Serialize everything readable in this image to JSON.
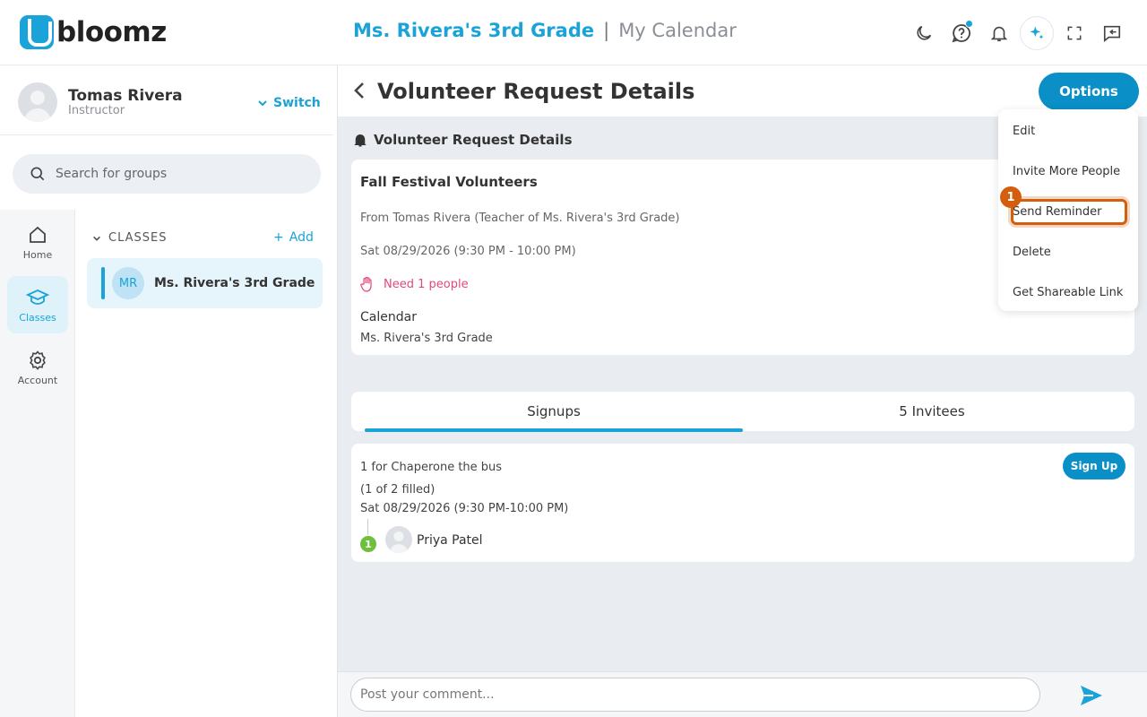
{
  "app": {
    "logo_text": "bloomz"
  },
  "header": {
    "group_name": "Ms. Rivera's 3rd Grade",
    "separator": "|",
    "page_name": "My Calendar",
    "icons": [
      "moon-icon",
      "help-icon",
      "bell-icon",
      "sparkle-icon",
      "fullscreen-icon",
      "message-icon"
    ]
  },
  "profile": {
    "name": "Tomas Rivera",
    "role": "Instructor",
    "switch_label": "Switch"
  },
  "search": {
    "placeholder": "Search for groups"
  },
  "rail": {
    "items": [
      {
        "label": "Home",
        "icon": "home-icon",
        "active": false
      },
      {
        "label": "Classes",
        "icon": "graduation-cap-icon",
        "active": true
      },
      {
        "label": "Account",
        "icon": "gear-icon",
        "active": false
      }
    ]
  },
  "groups": {
    "section_label": "CLASSES",
    "add_label": "Add",
    "items": [
      {
        "initials": "MR",
        "name": "Ms. Rivera's 3rd Grade"
      }
    ]
  },
  "page": {
    "title": "Volunteer Request Details",
    "options_label": "Options"
  },
  "details": {
    "section_label": "Volunteer Request Details",
    "title": "Fall Festival Volunteers",
    "from": "From Tomas Rivera (Teacher of Ms. Rivera's 3rd Grade)",
    "date": "Sat 08/29/2026 (9:30 PM - 10:00 PM)",
    "need": "Need 1 people",
    "calendar_label": "Calendar",
    "calendar_value": "Ms. Rivera's 3rd Grade"
  },
  "tabs": [
    {
      "label": "Signups",
      "active": true
    },
    {
      "label": "5 Invitees",
      "active": false
    }
  ],
  "signup": {
    "slot": "1 for Chaperone the bus",
    "filled": "(1 of 2 filled)",
    "time": "Sat 08/29/2026 (9:30 PM-10:00 PM)",
    "button_label": "Sign Up",
    "participant_number": "1",
    "participant_name": "Priya Patel"
  },
  "comment": {
    "placeholder": "Post your comment..."
  },
  "options_menu": {
    "items": [
      "Edit",
      "Invite More People",
      "Send Reminder",
      "Delete",
      "Get Shareable Link"
    ],
    "highlighted": "Send Reminder",
    "step_badge": "1"
  },
  "colors": {
    "accent": "#1aa3d8",
    "primary_button": "#0a8fc6",
    "need_text": "#e3487c",
    "highlight": "#d35f0e",
    "badge_green": "#6fbf3f"
  }
}
